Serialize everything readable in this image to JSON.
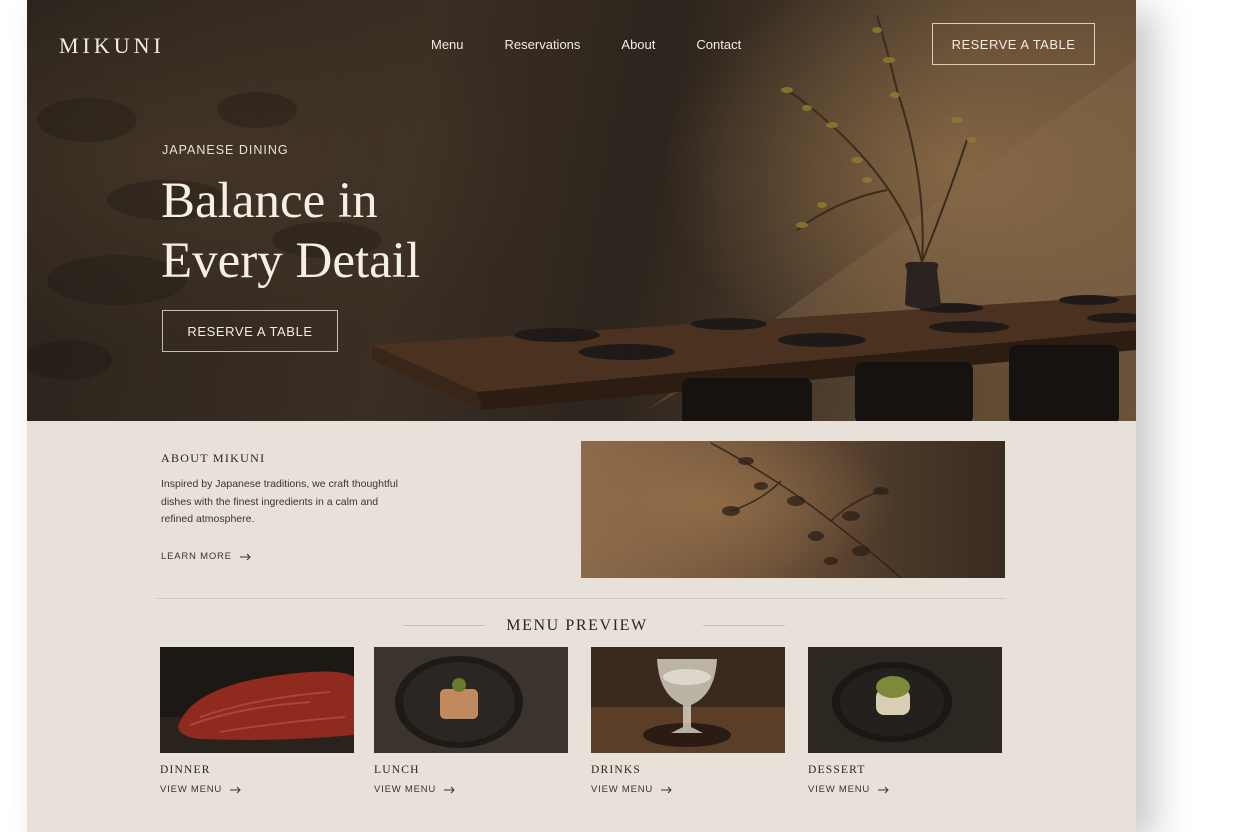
{
  "brand": {
    "logo": "MIKUNI"
  },
  "nav": {
    "items": [
      "Menu",
      "Reservations",
      "About",
      "Contact"
    ],
    "cta": "RESERVE A TABLE"
  },
  "hero": {
    "eyebrow": "JAPANESE DINING",
    "title_line1": "Balance in",
    "title_line2": "Every Detail",
    "cta": "RESERVE A TABLE"
  },
  "about": {
    "title": "ABOUT MIKUNI",
    "text": "Inspired by Japanese traditions, we craft thoughtful dishes with the finest ingredients in a calm and refined atmosphere.",
    "link": "LEARN MORE"
  },
  "menu_preview": {
    "heading": "MENU PREVIEW",
    "cards": [
      {
        "name": "DINNER",
        "link": "VIEW MENU"
      },
      {
        "name": "LUNCH",
        "link": "VIEW MENU"
      },
      {
        "name": "DRINKS",
        "link": "VIEW MENU"
      },
      {
        "name": "DESSERT",
        "link": "VIEW MENU"
      }
    ]
  },
  "colors": {
    "background": "#e7e1d9",
    "hero_dark": "#2a231c",
    "text_light": "#f2ece3",
    "text_dark": "#2b2520"
  },
  "icons": [
    "arrow-right-icon"
  ]
}
